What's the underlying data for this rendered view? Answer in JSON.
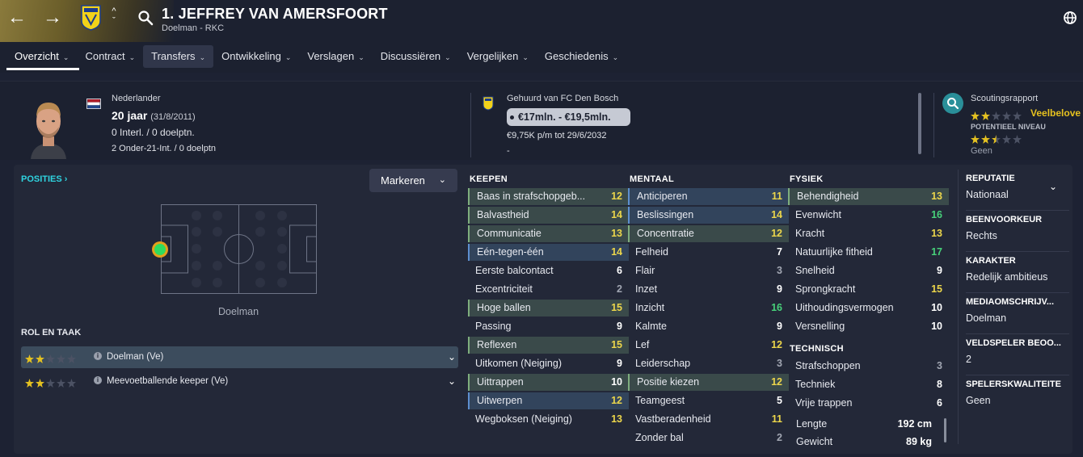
{
  "header": {
    "title": "1. JEFFREY VAN AMERSFOORT",
    "subtitle": "Doelman - RKC",
    "back_icon": "arrow-left-icon",
    "forward_icon": "arrow-right-icon"
  },
  "tabs": [
    {
      "label": "Overzicht",
      "chev": "⌄"
    },
    {
      "label": "Contract",
      "chev": "⌄"
    },
    {
      "label": "Transfers",
      "chev": "⌄"
    },
    {
      "label": "Ontwikkeling",
      "chev": "⌄"
    },
    {
      "label": "Verslagen",
      "chev": "⌄"
    },
    {
      "label": "Discussiëren",
      "chev": "⌄"
    },
    {
      "label": "Vergelijken",
      "chev": "⌄"
    },
    {
      "label": "Geschiedenis",
      "chev": "⌄"
    }
  ],
  "player": {
    "nationality": "Nederlander",
    "age": "20 jaar",
    "dob": "(31/8/2011)",
    "caps": "0 Interl. / 0 doelptn.",
    "u21": "2 Onder-21-Int. / 0 doelptn"
  },
  "contract": {
    "loan": "Gehuurd van FC Den Bosch",
    "value": "€17mln. - €19,5mln.",
    "wage": "€9,75K p/m tot 29/6/2032",
    "dash": "-"
  },
  "scouting": {
    "label": "Scoutingsrapport",
    "verdict": "Veelbelove",
    "potential_label": "POTENTIEEL NIVEAU",
    "current_stars": 2,
    "potential_stars": 2.5,
    "geen": "Geen",
    "colors": {
      "star": "#e4c121",
      "accent": "#2fd4e0"
    }
  },
  "positions": {
    "title": "POSITIES",
    "marker_btn": "Markeren",
    "pitch_label": "Doelman"
  },
  "roles": {
    "title": "ROL EN TAAK",
    "items": [
      {
        "label": "Doelman (Ve)",
        "stars": 2,
        "selected": true
      },
      {
        "label": "Meevoetballende keeper (Ve)",
        "stars": 2,
        "selected": false
      }
    ]
  },
  "keepen": {
    "title": "KEEPEN",
    "items": [
      {
        "name": "Baas in strafschopgeb...",
        "value": "12",
        "hl": "g"
      },
      {
        "name": "Balvastheid",
        "value": "14",
        "hl": "g"
      },
      {
        "name": "Communicatie",
        "value": "13",
        "hl": "g"
      },
      {
        "name": "Eén-tegen-één",
        "value": "14",
        "hl": "b"
      },
      {
        "name": "Eerste balcontact",
        "value": "6",
        "hl": ""
      },
      {
        "name": "Excentriciteit",
        "value": "2",
        "hl": ""
      },
      {
        "name": "Hoge ballen",
        "value": "15",
        "hl": "g"
      },
      {
        "name": "Passing",
        "value": "9",
        "hl": ""
      },
      {
        "name": "Reflexen",
        "value": "15",
        "hl": "g"
      },
      {
        "name": "Uitkomen (Neiging)",
        "value": "9",
        "hl": ""
      },
      {
        "name": "Uittrappen",
        "value": "10",
        "hl": "g"
      },
      {
        "name": "Uitwerpen",
        "value": "12",
        "hl": "b"
      },
      {
        "name": "Wegboksen (Neiging)",
        "value": "13",
        "hl": ""
      }
    ]
  },
  "mentaal": {
    "title": "MENTAAL",
    "items": [
      {
        "name": "Anticiperen",
        "value": "11",
        "hl": "b"
      },
      {
        "name": "Beslissingen",
        "value": "14",
        "hl": "b"
      },
      {
        "name": "Concentratie",
        "value": "12",
        "hl": "g"
      },
      {
        "name": "Felheid",
        "value": "7",
        "hl": ""
      },
      {
        "name": "Flair",
        "value": "3",
        "hl": ""
      },
      {
        "name": "Inzet",
        "value": "9",
        "hl": ""
      },
      {
        "name": "Inzicht",
        "value": "16",
        "hl": ""
      },
      {
        "name": "Kalmte",
        "value": "9",
        "hl": ""
      },
      {
        "name": "Lef",
        "value": "12",
        "hl": ""
      },
      {
        "name": "Leiderschap",
        "value": "3",
        "hl": ""
      },
      {
        "name": "Positie kiezen",
        "value": "12",
        "hl": "g"
      },
      {
        "name": "Teamgeest",
        "value": "5",
        "hl": ""
      },
      {
        "name": "Vastberadenheid",
        "value": "11",
        "hl": ""
      },
      {
        "name": "Zonder bal",
        "value": "2",
        "hl": ""
      }
    ]
  },
  "fysiek": {
    "title": "FYSIEK",
    "items": [
      {
        "name": "Behendigheid",
        "value": "13",
        "hl": "g"
      },
      {
        "name": "Evenwicht",
        "value": "16",
        "hl": ""
      },
      {
        "name": "Kracht",
        "value": "13",
        "hl": ""
      },
      {
        "name": "Natuurlijke fitheid",
        "value": "17",
        "hl": ""
      },
      {
        "name": "Snelheid",
        "value": "9",
        "hl": ""
      },
      {
        "name": "Sprongkracht",
        "value": "15",
        "hl": ""
      },
      {
        "name": "Uithoudingsvermogen",
        "value": "10",
        "hl": ""
      },
      {
        "name": "Versnelling",
        "value": "10",
        "hl": ""
      }
    ]
  },
  "technisch": {
    "title": "TECHNISCH",
    "items": [
      {
        "name": "Strafschoppen",
        "value": "3",
        "hl": ""
      },
      {
        "name": "Techniek",
        "value": "8",
        "hl": ""
      },
      {
        "name": "Vrije trappen",
        "value": "6",
        "hl": ""
      }
    ]
  },
  "physical": {
    "height_label": "Lengte",
    "height": "192 cm",
    "weight_label": "Gewicht",
    "weight": "89 kg"
  },
  "right": [
    {
      "h": "REPUTATIE",
      "v": "Nationaal"
    },
    {
      "h": "BEENVOORKEUR",
      "v": "Rechts"
    },
    {
      "h": "KARAKTER",
      "v": "Redelijk ambitieus"
    },
    {
      "h": "MEDIAOMSCHRIJV...",
      "v": "Doelman"
    },
    {
      "h": "VELDSPELER BEOO...",
      "v": "2"
    },
    {
      "h": "SPELERSKWALITEITE",
      "v": "Geen"
    }
  ]
}
